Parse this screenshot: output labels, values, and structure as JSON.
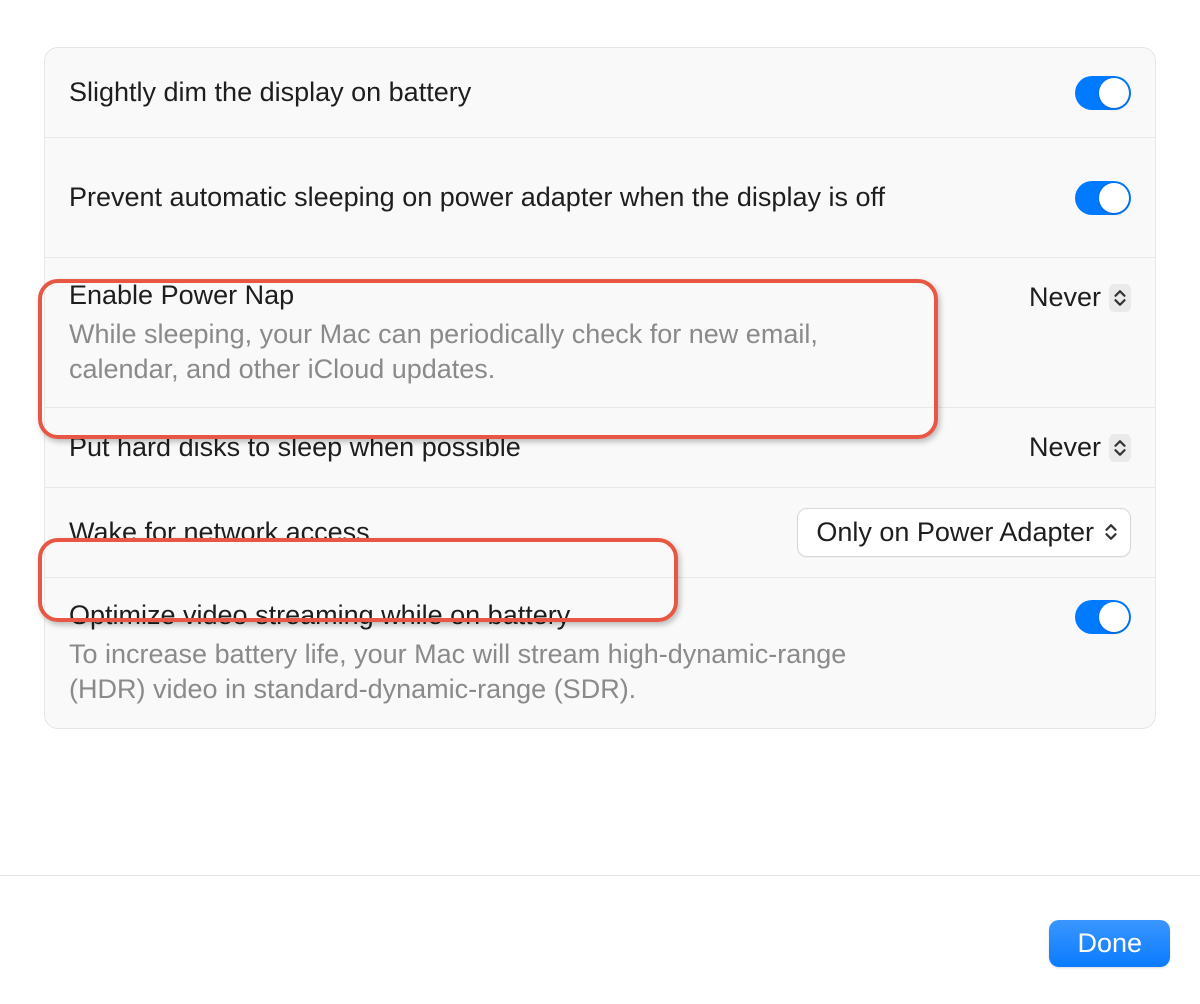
{
  "settings": {
    "dim_display": {
      "title": "Slightly dim the display on battery",
      "toggle_on": true
    },
    "prevent_sleep": {
      "title": "Prevent automatic sleeping on power adapter when the display is off",
      "toggle_on": true
    },
    "power_nap": {
      "title": "Enable Power Nap",
      "desc": "While sleeping, your Mac can periodically check for new email, calendar, and other iCloud updates.",
      "value": "Never"
    },
    "hard_disks": {
      "title": "Put hard disks to sleep when possible",
      "value": "Never"
    },
    "wake_network": {
      "title": "Wake for network access",
      "value": "Only on Power Adapter"
    },
    "optimize_video": {
      "title": "Optimize video streaming while on battery",
      "desc": "To increase battery life, your Mac will stream high-dynamic-range (HDR) video in standard-dynamic-range (SDR).",
      "toggle_on": true
    }
  },
  "footer": {
    "done_label": "Done"
  },
  "colors": {
    "accent": "#007aff",
    "highlight": "#e85743"
  }
}
